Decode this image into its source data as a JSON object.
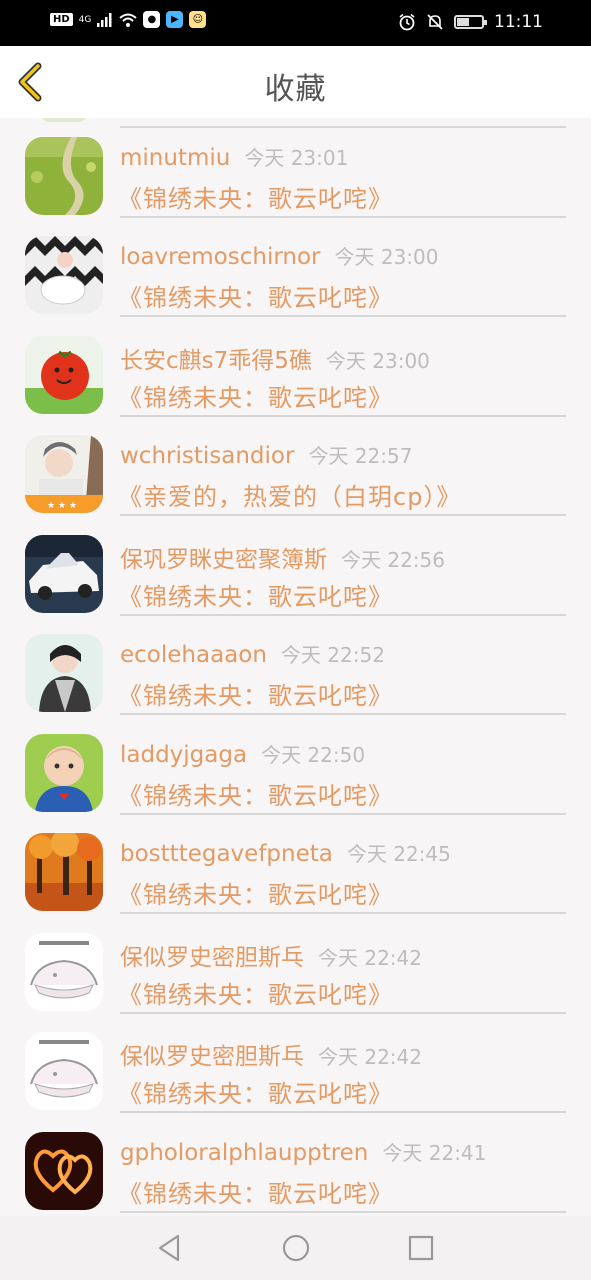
{
  "status_bar": {
    "network_hd": "HD",
    "network_type": "4G",
    "time": "11:11"
  },
  "header": {
    "title": "收藏",
    "back_icon": "chevron-left-icon"
  },
  "items": [
    {
      "name": "minutmiu",
      "time": "今天 23:01",
      "book": "《锦绣未央：歌云叱咤》",
      "avatar": "field-path"
    },
    {
      "name": "loavremoschirnor",
      "time": "今天 23:00",
      "book": "《锦绣未央：歌云叱咤》",
      "avatar": "zigzag-cup"
    },
    {
      "name": "长安c麒s7乖得5礁",
      "time": "今天 23:00",
      "book": "《锦绣未央：歌云叱咤》",
      "avatar": "tomato"
    },
    {
      "name": "wchristisandior",
      "time": "今天 22:57",
      "book": "《亲爱的，热爱的（白玥cp）》",
      "avatar": "girl-photo"
    },
    {
      "name": "保巩罗眯史密聚簿斯",
      "time": "今天 22:56",
      "book": "《锦绣未央：歌云叱咤》",
      "avatar": "car"
    },
    {
      "name": "ecolehaaaon",
      "time": "今天 22:52",
      "book": "《锦绣未央：歌云叱咤》",
      "avatar": "person"
    },
    {
      "name": "laddyjgaga",
      "time": "今天 22:50",
      "book": "《锦绣未央：歌云叱咤》",
      "avatar": "baby"
    },
    {
      "name": "bostttegavefpneta",
      "time": "今天 22:45",
      "book": "《锦绣未央：歌云叱咤》",
      "avatar": "autumn-trees"
    },
    {
      "name": "保似罗史密胆斯乓",
      "time": "今天 22:42",
      "book": "《锦绣未央：歌云叱咤》",
      "avatar": "sketch"
    },
    {
      "name": "保似罗史密胆斯乓",
      "time": "今天 22:42",
      "book": "《锦绣未央：歌云叱咤》",
      "avatar": "sketch"
    },
    {
      "name": "gpholoralphlaupptren",
      "time": "今天 22:41",
      "book": "《锦绣未央：歌云叱咤》",
      "avatar": "hearts"
    }
  ],
  "nav_bar": {
    "back": "triangle-back-icon",
    "home": "circle-home-icon",
    "recent": "square-recent-icon"
  },
  "colors": {
    "accent": "#e49a63",
    "time_text": "#bdbdbd",
    "back_chevron": "#f0c419",
    "divider": "#d6d6d6"
  }
}
